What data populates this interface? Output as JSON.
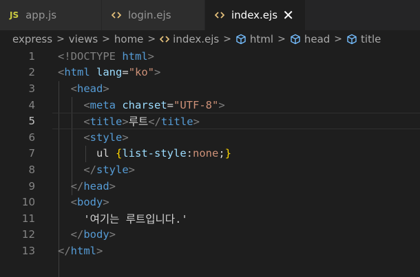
{
  "tabs": [
    {
      "icon": "JS",
      "label": "app.js",
      "active": false
    },
    {
      "icon": "<>",
      "label": "login.ejs",
      "active": false
    },
    {
      "icon": "<>",
      "label": "index.ejs",
      "active": true,
      "close": "✕"
    }
  ],
  "breadcrumb": {
    "items": [
      "express",
      "views",
      "home",
      "index.ejs",
      "html",
      "head",
      "title"
    ],
    "separator": ">"
  },
  "editor": {
    "current_line": 5,
    "lines": [
      {
        "num": "1"
      },
      {
        "num": "2"
      },
      {
        "num": "3"
      },
      {
        "num": "4"
      },
      {
        "num": "5"
      },
      {
        "num": "6"
      },
      {
        "num": "7"
      },
      {
        "num": "8"
      },
      {
        "num": "9"
      },
      {
        "num": "10"
      },
      {
        "num": "11"
      },
      {
        "num": "12"
      },
      {
        "num": "13"
      }
    ],
    "tokens": {
      "doctype": "<!DOCTYPE",
      "html_kw": "html",
      "lt": "<",
      "gt": ">",
      "lt_slash": "</",
      "html": "html",
      "lang_attr": "lang",
      "eq": "=",
      "lang_val": "\"ko\"",
      "head": "head",
      "meta": "meta",
      "charset_attr": "charset",
      "charset_val": "\"UTF-8\"",
      "title": "title",
      "title_text": "루트",
      "style": "style",
      "css_sel": "ul ",
      "css_open": "{",
      "css_prop": "list-style",
      "css_colon": ":",
      "css_val": "none",
      "css_semi": ";",
      "css_close": "}",
      "body": "body",
      "body_text": "'여기는 루트입니다.'"
    }
  },
  "colors": {
    "background": "#1e1e1e",
    "tag": "#569cd6",
    "attr": "#9cdcfe",
    "string": "#ce9178",
    "brace": "#ffd700"
  }
}
